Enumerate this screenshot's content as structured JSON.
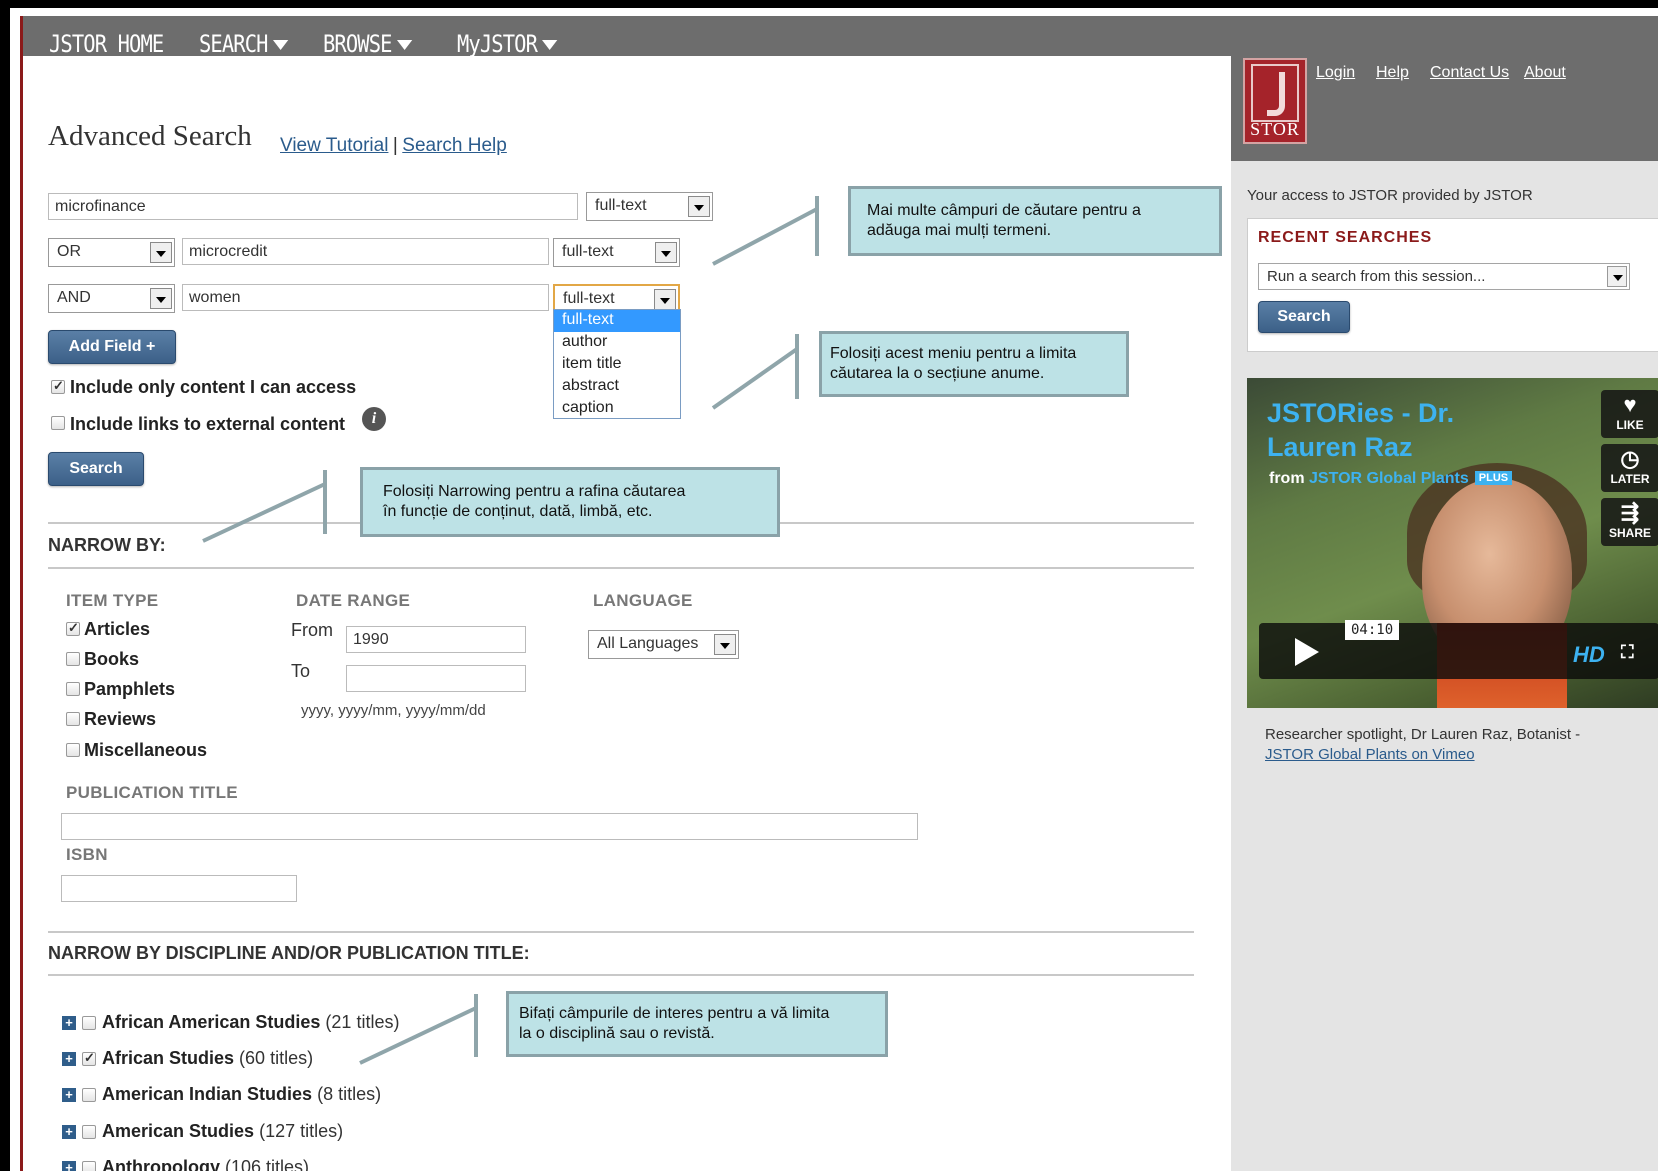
{
  "nav": {
    "home": "JSTOR HOME",
    "search": "SEARCH",
    "browse": "BROWSE",
    "myjstor": "MyJSTOR"
  },
  "top_links": {
    "login": "Login",
    "help": "Help",
    "contact": "Contact Us",
    "about": "About"
  },
  "logo_text": "STOR",
  "page": {
    "title": "Advanced Search",
    "tutorial": "View Tutorial",
    "sep": "|",
    "search_help": "Search Help"
  },
  "rows": [
    {
      "term": "microfinance",
      "field": "full-text"
    },
    {
      "op": "OR",
      "term": "microcredit",
      "field": "full-text"
    },
    {
      "op": "AND",
      "term": "women",
      "field": "full-text"
    }
  ],
  "field_options": [
    "full-text",
    "author",
    "item title",
    "abstract",
    "caption"
  ],
  "add_field": "Add Field +",
  "include_access": "Include only content I can access",
  "include_external": "Include links to external content",
  "info_glyph": "i",
  "search_label": "Search",
  "narrow": {
    "title": "NARROW BY:",
    "item_type": "ITEM TYPE",
    "items": [
      {
        "label": "Articles",
        "checked": true
      },
      {
        "label": "Books",
        "checked": false
      },
      {
        "label": "Pamphlets",
        "checked": false
      },
      {
        "label": "Reviews",
        "checked": false
      },
      {
        "label": "Miscellaneous",
        "checked": false
      }
    ],
    "date_range": "DATE RANGE",
    "from": "From",
    "from_value": "1990",
    "to": "To",
    "date_hint": "yyyy, yyyy/mm, yyyy/mm/dd",
    "language": "LANGUAGE",
    "language_value": "All Languages",
    "pub_title": "PUBLICATION TITLE",
    "isbn": "ISBN"
  },
  "discipline": {
    "title": "NARROW BY DISCIPLINE AND/OR PUBLICATION TITLE:",
    "items": [
      {
        "name": "African American Studies",
        "count": "(21 titles)",
        "checked": false
      },
      {
        "name": "African Studies",
        "count": "(60 titles)",
        "checked": true
      },
      {
        "name": "American Indian Studies",
        "count": "(8 titles)",
        "checked": false
      },
      {
        "name": "American Studies",
        "count": "(127 titles)",
        "checked": false
      },
      {
        "name": "Anthropology",
        "count": "(106 titles)",
        "checked": false
      }
    ]
  },
  "right": {
    "access": "Your access to JSTOR provided by JSTOR",
    "recent_title": "RECENT SEARCHES",
    "recent_placeholder": "Run a search from this session...",
    "search": "Search"
  },
  "video": {
    "title_line1": "JSTORies - Dr.",
    "title_line2": "Lauren Raz",
    "from": "from",
    "from_source": "JSTOR Global Plants",
    "plus": "PLUS",
    "like": "LIKE",
    "later": "LATER",
    "share": "SHARE",
    "time": "04:10",
    "hd": "HD",
    "caption": "Researcher spotlight, Dr Lauren Raz, Botanist -",
    "caption_link": "JSTOR Global Plants on Vimeo"
  },
  "callouts": {
    "c1_l1": "Mai multe câmpuri de căutare pentru a",
    "c1_l2": "adăuga mai mulți termeni.",
    "c2_l1": "Folosiți acest meniu pentru a limita",
    "c2_l2": "căutarea la o secțiune anume.",
    "c3_l1": "Folosiți Narrowing pentru a rafina căutarea",
    "c3_l2": "în funcție de conținut, dată, limbă, etc.",
    "c4_l1": "Bifați câmpurile de interes pentru a vă limita",
    "c4_l2": "la o disciplină sau o revistă."
  }
}
